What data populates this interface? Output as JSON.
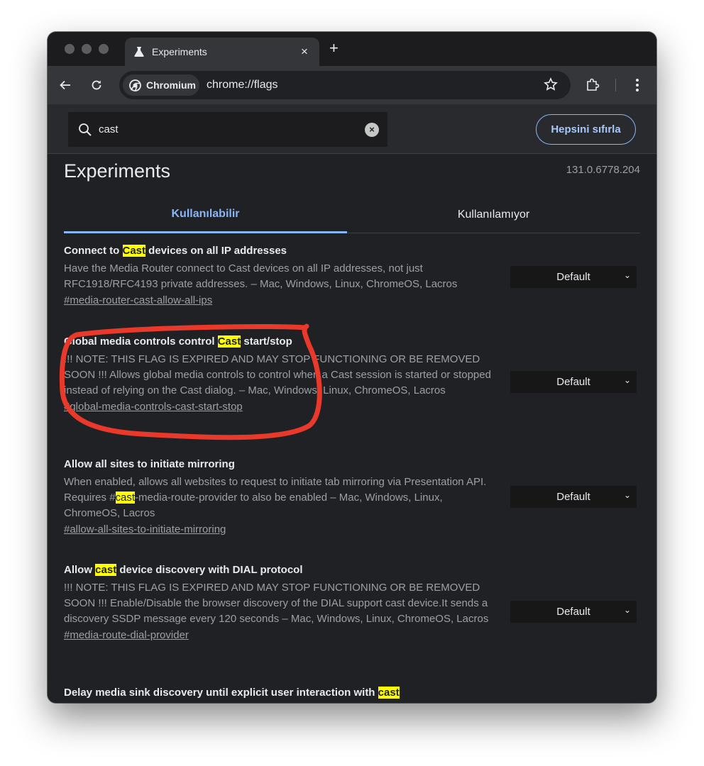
{
  "browser": {
    "tab_title": "Experiments",
    "tab_close": "×",
    "new_tab": "+",
    "chip_label": "Chromium",
    "url": "chrome://flags"
  },
  "flags_page": {
    "search_value": "cast",
    "reset_label": "Hepsini sıfırla",
    "title": "Experiments",
    "version": "131.0.6778.204",
    "tabs": [
      {
        "label": "Kullanılabilir",
        "active": true
      },
      {
        "label": "Kullanılamıyor",
        "active": false
      }
    ],
    "experiments": [
      {
        "name_pre": "Connect to ",
        "name_hl": "Cast",
        "name_post": " devices on all IP addresses",
        "desc_pre": "Have the Media Router connect to Cast devices on all IP addresses, not just RFC1918/RFC4193 private addresses. – Mac, Windows, Linux, ChromeOS, Lacros",
        "desc_hl": "",
        "desc_post": "",
        "link": "#media-router-cast-allow-all-ips",
        "select": "Default"
      },
      {
        "name_pre": "Global media controls control ",
        "name_hl": "Cast",
        "name_post": " start/stop",
        "desc_pre": "!!! NOTE: THIS FLAG IS EXPIRED AND MAY STOP FUNCTIONING OR BE REMOVED SOON !!! Allows global media controls to control when a Cast session is started or stopped instead of relying on the Cast dialog. – Mac, Windows, Linux, ChromeOS, Lacros",
        "desc_hl": "",
        "desc_post": "",
        "link": "#global-media-controls-cast-start-stop",
        "select": "Default"
      },
      {
        "name_pre": "Allow all sites to initiate mirroring",
        "name_hl": "",
        "name_post": "",
        "desc_pre": "When enabled, allows all websites to request to initiate tab mirroring via Presentation API. Requires #",
        "desc_hl": "cast",
        "desc_post": "-media-route-provider to also be enabled – Mac, Windows, Linux, ChromeOS, Lacros",
        "link": "#allow-all-sites-to-initiate-mirroring",
        "select": "Default"
      },
      {
        "name_pre": "Allow ",
        "name_hl": "cast",
        "name_post": " device discovery with DIAL protocol",
        "desc_pre": "!!! NOTE: THIS FLAG IS EXPIRED AND MAY STOP FUNCTIONING OR BE REMOVED SOON !!! Enable/Disable the browser discovery of the DIAL support cast device.It sends a discovery SSDP message every 120 seconds – Mac, Windows, Linux, ChromeOS, Lacros",
        "desc_hl": "",
        "desc_post": "",
        "link": "#media-route-dial-provider",
        "select": "Default"
      },
      {
        "name_pre": "Delay media sink discovery until explicit user interaction with ",
        "name_hl": "cast",
        "name_post": "",
        "desc_pre": "",
        "desc_hl": "",
        "desc_post": "",
        "link": "",
        "select": ""
      }
    ]
  },
  "icons": {
    "tab": "flask-icon",
    "back": "back-arrow-icon",
    "reload": "reload-icon",
    "chip": "chromium-icon",
    "bookmark": "star-icon",
    "extensions": "puzzle-icon",
    "menu": "kebab-menu-icon",
    "search": "search-icon",
    "clear": "clear-icon",
    "dropdown": "chevron-down-icon"
  },
  "colors": {
    "accent": "#8ab4f8",
    "highlight": "#ffff00",
    "annotation": "#e8392b"
  }
}
